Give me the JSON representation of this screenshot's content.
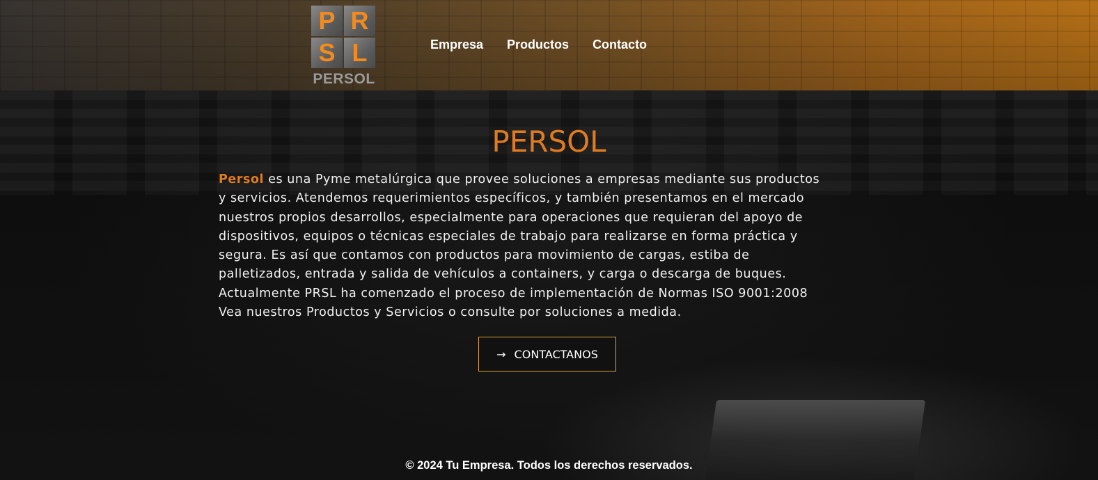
{
  "header": {
    "logo": {
      "letters": [
        "P",
        "R",
        "S",
        "L"
      ],
      "name": "PERSOL"
    },
    "nav": [
      {
        "label": "Empresa"
      },
      {
        "label": "Productos"
      },
      {
        "label": "Contacto"
      }
    ]
  },
  "main": {
    "title": "PERSOL",
    "brand_word": "Persol",
    "description_lines": [
      " es una Pyme metalúrgica que provee soluciones a empresas mediante sus productos",
      "y servicios. Atendemos requerimientos específicos, y también presentamos en el mercado",
      "nuestros propios desarrollos, especialmente para operaciones que requieran del apoyo de",
      "dispositivos, equipos o técnicas especiales de trabajo para realizarse en forma práctica y",
      "segura. Es así que contamos con productos para movimiento de cargas, estiba de",
      "palletizados, entrada y salida de vehículos a containers, y carga o descarga de buques.",
      "Actualmente PRSL ha comenzado el proceso de implementación de Normas ISO 9001:2008",
      "Vea nuestros Productos y Servicios o consulte por soluciones a medida."
    ],
    "cta": {
      "arrow": "→",
      "label": "CONTACTANOS"
    }
  },
  "footer": {
    "text": "© 2024 Tu Empresa. Todos los derechos reservados."
  },
  "colors": {
    "accent": "#e07b1f",
    "cta_border": "#e0a33a",
    "logo_letters": "#f28a1e"
  }
}
